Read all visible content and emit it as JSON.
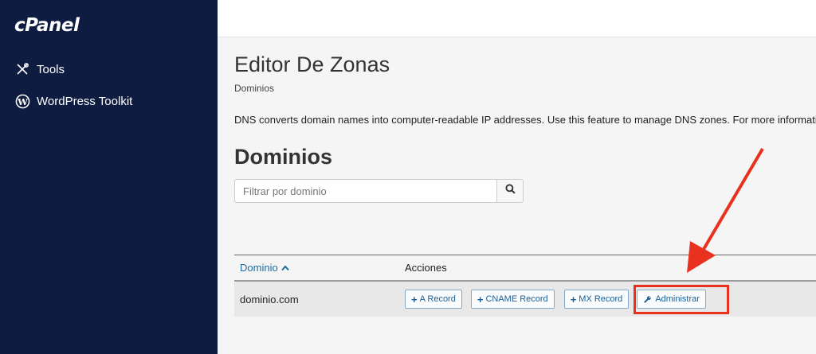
{
  "sidebar": {
    "logo": "cPanel",
    "items": [
      {
        "label": "Tools",
        "icon": "tools-icon"
      },
      {
        "label": "WordPress Toolkit",
        "icon": "wordpress-icon"
      }
    ]
  },
  "main": {
    "title": "Editor De Zonas",
    "breadcrumb": "Dominios",
    "description": "DNS converts domain names into computer-readable IP addresses. Use this feature to manage DNS zones. For more information,",
    "section_title": "Dominios",
    "search": {
      "placeholder": "Filtrar por dominio",
      "value": ""
    }
  },
  "table": {
    "columns": [
      "Dominio",
      "Acciones"
    ],
    "rows": [
      {
        "domain": "dominio.com",
        "actions": [
          "A Record",
          "CNAME Record",
          "MX Record",
          "Administrar"
        ]
      }
    ]
  },
  "colors": {
    "sidebar_bg": "#0f1c41",
    "link_blue": "#1a6ba3",
    "annotation_red": "#e8321f"
  }
}
